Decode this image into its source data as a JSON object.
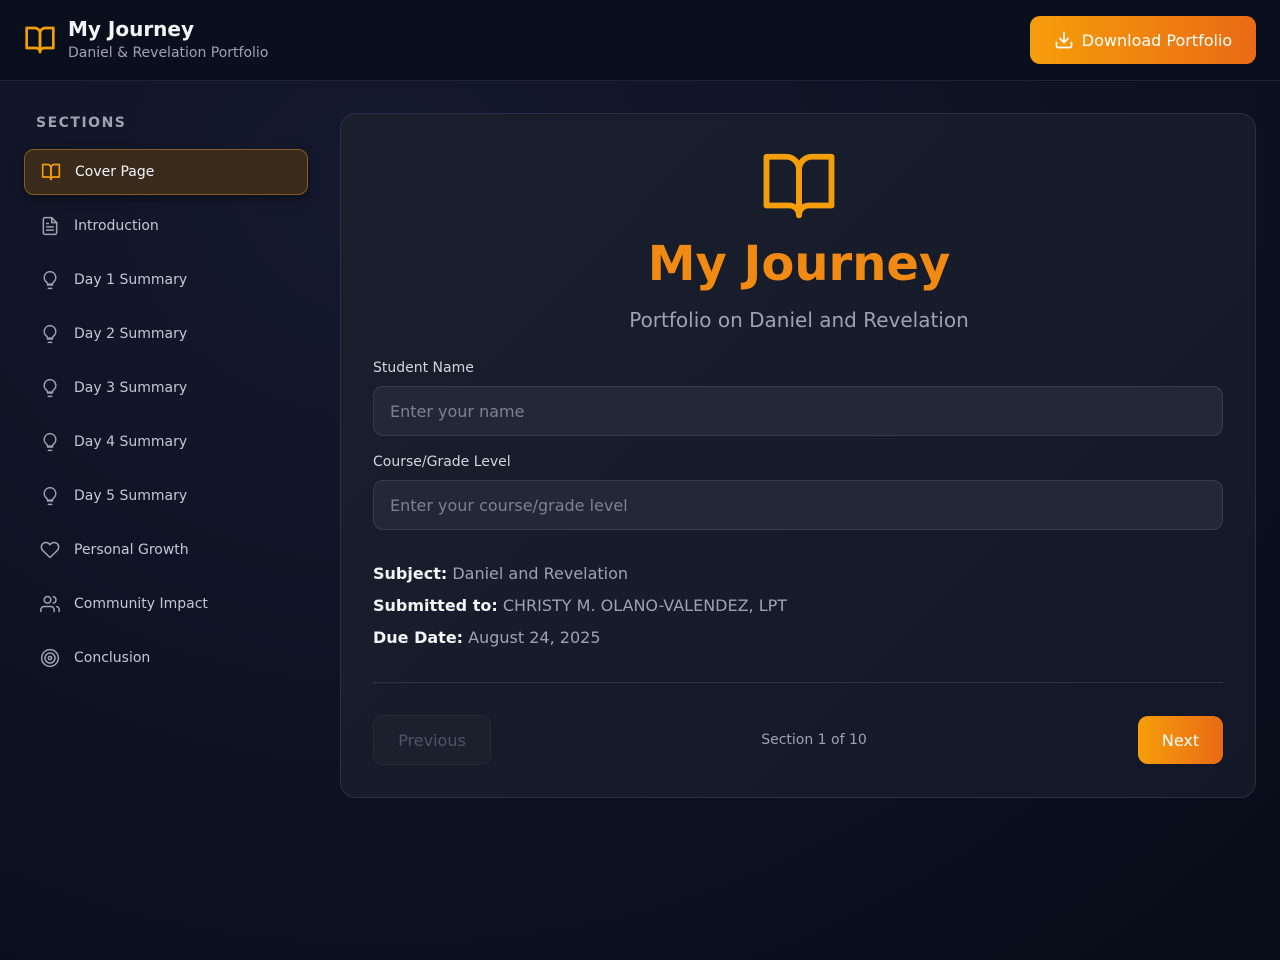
{
  "colors": {
    "accent": "#f08a13",
    "accent_gradient_start": "#f59e0b",
    "accent_gradient_end": "#ea6a14",
    "background": "#0d1222"
  },
  "header": {
    "logo_icon": "open-book-icon",
    "title": "My Journey",
    "subtitle": "Daniel & Revelation Portfolio",
    "download_label": "Download Portfolio",
    "download_icon": "download-icon"
  },
  "sidebar": {
    "heading": "SECTIONS",
    "items": [
      {
        "label": "Cover Page",
        "icon": "open-book-icon",
        "active": true
      },
      {
        "label": "Introduction",
        "icon": "document-icon",
        "active": false
      },
      {
        "label": "Day 1 Summary",
        "icon": "lightbulb-icon",
        "active": false
      },
      {
        "label": "Day 2 Summary",
        "icon": "lightbulb-icon",
        "active": false
      },
      {
        "label": "Day 3 Summary",
        "icon": "lightbulb-icon",
        "active": false
      },
      {
        "label": "Day 4 Summary",
        "icon": "lightbulb-icon",
        "active": false
      },
      {
        "label": "Day 5 Summary",
        "icon": "lightbulb-icon",
        "active": false
      },
      {
        "label": "Personal Growth",
        "icon": "heart-icon",
        "active": false
      },
      {
        "label": "Community Impact",
        "icon": "users-icon",
        "active": false
      },
      {
        "label": "Conclusion",
        "icon": "target-icon",
        "active": false
      }
    ]
  },
  "cover": {
    "icon": "open-book-icon",
    "title": "My Journey",
    "subtitle": "Portfolio on Daniel and Revelation",
    "student_name_label": "Student Name",
    "student_name_placeholder": "Enter your name",
    "student_name_value": "",
    "course_label": "Course/Grade Level",
    "course_placeholder": "Enter your course/grade level",
    "course_value": "",
    "subject_label": "Subject:",
    "subject_value": "Daniel and Revelation",
    "submitted_label": "Submitted to:",
    "submitted_value": "CHRISTY M. OLANO-VALENDEZ, LPT",
    "due_label": "Due Date:",
    "due_value": "August 24, 2025"
  },
  "pagination": {
    "previous_label": "Previous",
    "counter": "Section 1 of 10",
    "next_label": "Next"
  }
}
